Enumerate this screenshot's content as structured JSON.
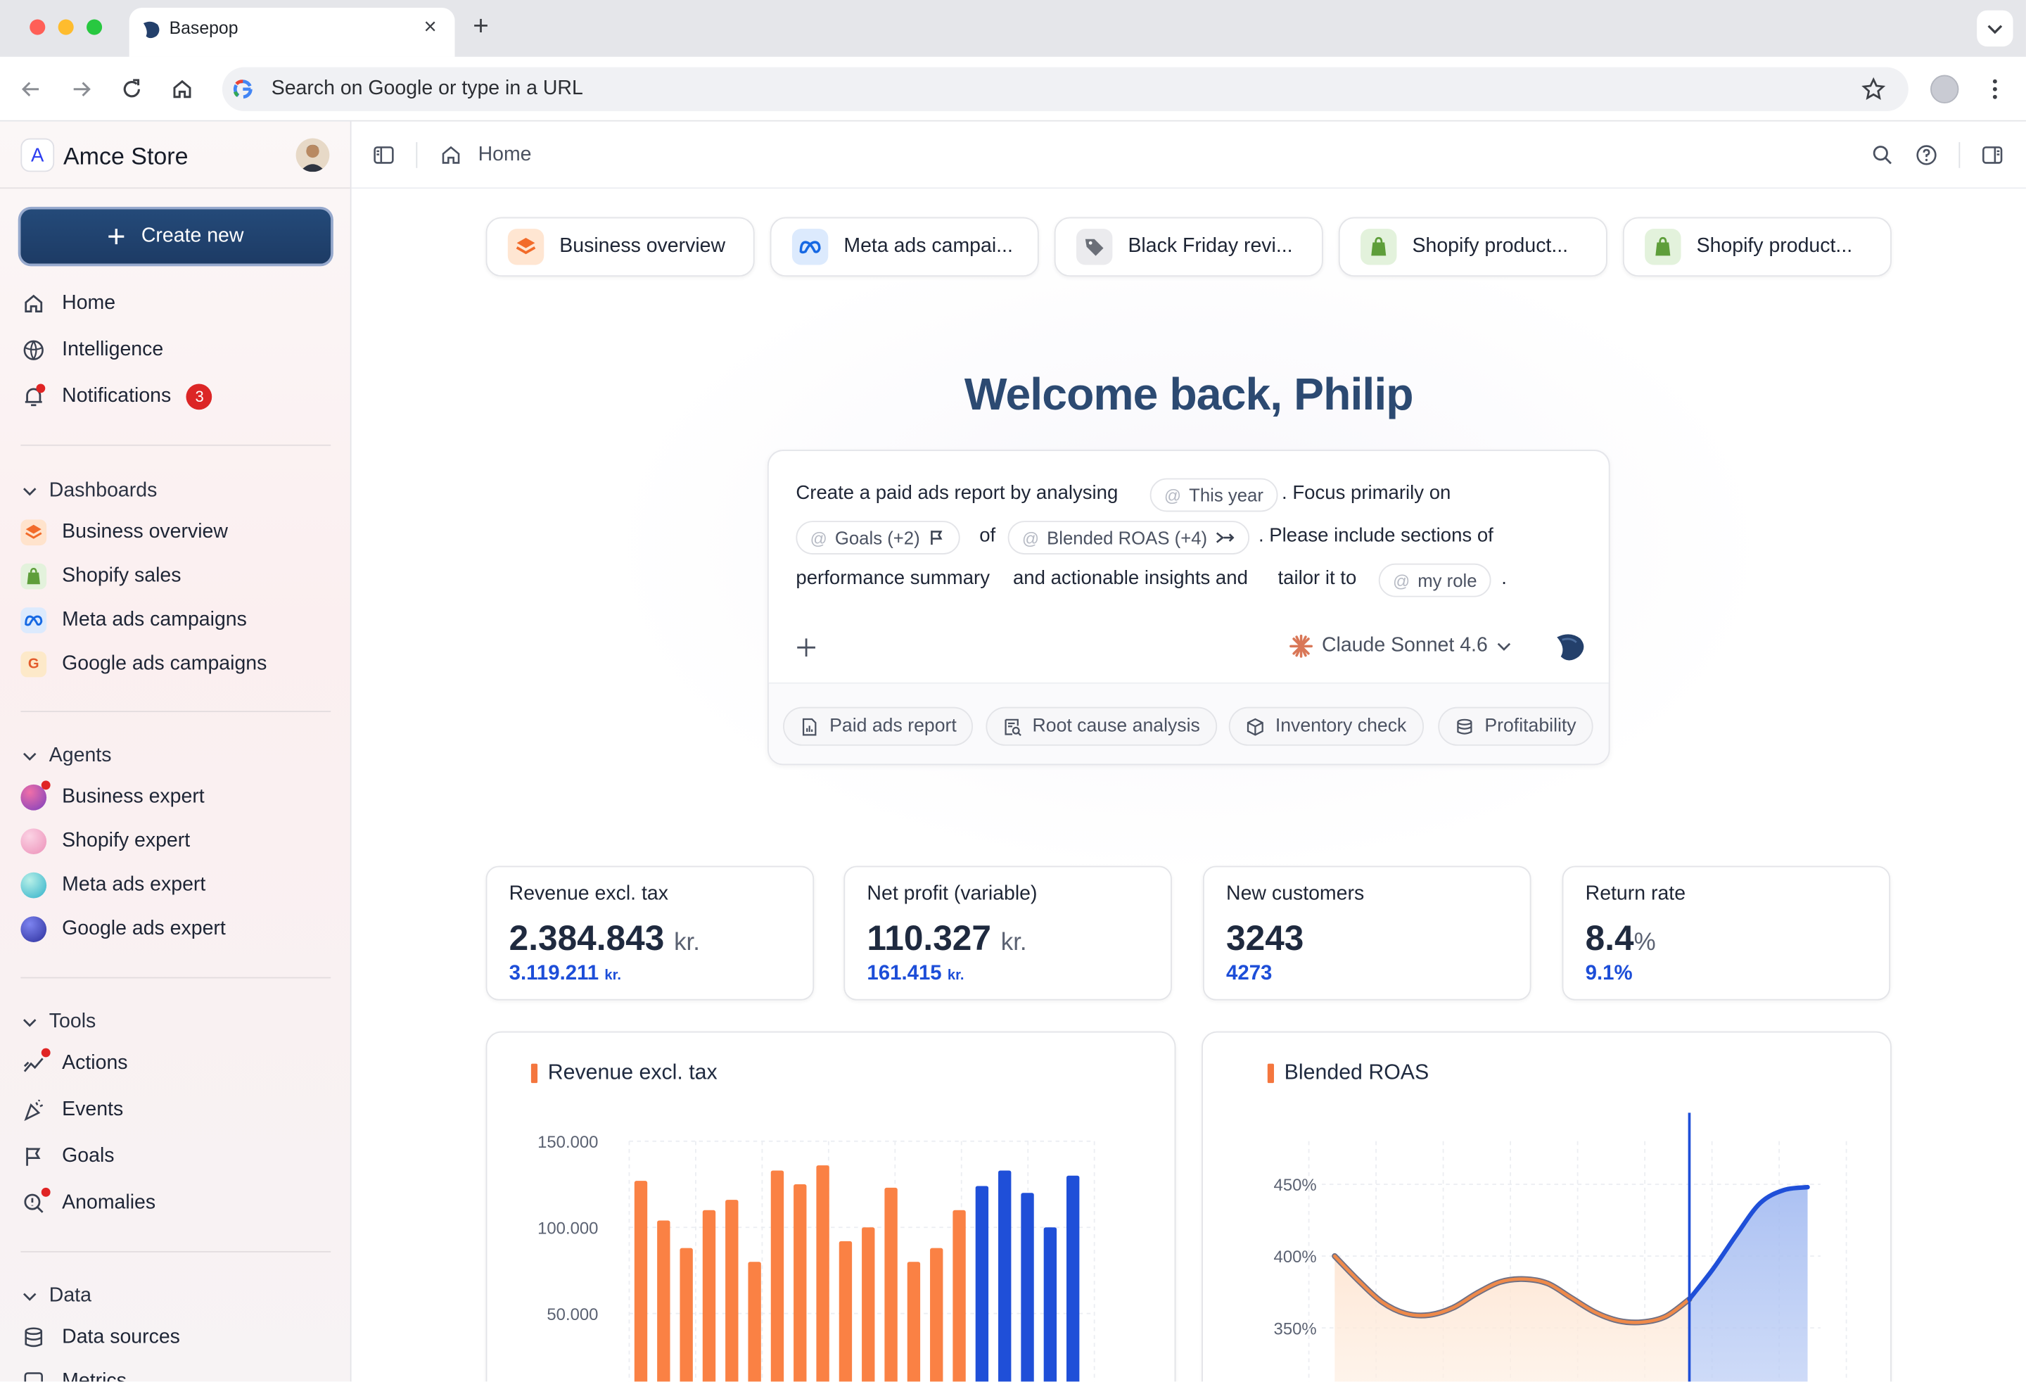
{
  "browser": {
    "tab_title": "Basepop",
    "tab_close": "×",
    "new_tab": "+",
    "omnibox_placeholder": "Search on Google or type in a URL"
  },
  "sidebar": {
    "store_initial": "A",
    "store_name": "Amce Store",
    "create_label": "Create new",
    "nav": [
      {
        "label": "Home",
        "icon": "home-icon"
      },
      {
        "label": "Intelligence",
        "icon": "intelligence-icon"
      },
      {
        "label": "Notifications",
        "icon": "bell-icon",
        "badge": "3"
      }
    ],
    "dashboards_title": "Dashboards",
    "dashboards": [
      {
        "label": "Business overview",
        "icon": "business-overview-icon"
      },
      {
        "label": "Shopify sales",
        "icon": "shopify-icon"
      },
      {
        "label": "Meta ads campaigns",
        "icon": "meta-icon"
      },
      {
        "label": "Google ads campaigns",
        "icon": "google-icon"
      }
    ],
    "agents_title": "Agents",
    "agents": [
      {
        "label": "Business expert",
        "color": "#7b3fbe"
      },
      {
        "label": "Shopify expert",
        "color": "#f3a6c8"
      },
      {
        "label": "Meta ads expert",
        "color": "#46c6c9"
      },
      {
        "label": "Google ads expert",
        "color": "#3d3fb3"
      }
    ],
    "tools_title": "Tools",
    "tools": [
      {
        "label": "Actions",
        "icon": "actions-icon"
      },
      {
        "label": "Events",
        "icon": "events-icon"
      },
      {
        "label": "Goals",
        "icon": "flag-icon"
      },
      {
        "label": "Anomalies",
        "icon": "anomalies-icon"
      }
    ],
    "data_title": "Data",
    "data_items": [
      {
        "label": "Data sources",
        "icon": "database-icon"
      },
      {
        "label": "Metrics",
        "icon": "metrics-icon"
      }
    ]
  },
  "header": {
    "breadcrumb": "Home"
  },
  "chips": [
    {
      "label": "Business overview"
    },
    {
      "label": "Meta ads campai..."
    },
    {
      "label": "Black Friday revi..."
    },
    {
      "label": "Shopify product..."
    },
    {
      "label": "Shopify product..."
    }
  ],
  "welcome": "Welcome back, Philip",
  "prompt": {
    "t1": "Create a paid ads report by analysing",
    "p_year": "This year",
    "t2": ". Focus primarily on",
    "p_goals": "Goals (+2)",
    "t3": "of",
    "p_roas": "Blended ROAS (+4)",
    "t4": ". Please include sections of",
    "t5": "performance summary",
    "t6": "and actionable insights and",
    "t7": "tailor it to",
    "p_role": "my role",
    "t8": ".",
    "at": "@",
    "model": "Claude Sonnet 4.6"
  },
  "suggestions": [
    {
      "label": "Paid ads report"
    },
    {
      "label": "Root cause analysis"
    },
    {
      "label": "Inventory check"
    },
    {
      "label": "Profitability"
    }
  ],
  "kpis": [
    {
      "label": "Revenue excl. tax",
      "value": "2.384.843",
      "unit": "kr.",
      "compare": "3.119.211",
      "compare_unit": "kr."
    },
    {
      "label": "Net profit (variable)",
      "value": "110.327",
      "unit": "kr.",
      "compare": "161.415",
      "compare_unit": "kr."
    },
    {
      "label": "New customers",
      "value": "3243",
      "unit": "",
      "compare": "4273",
      "compare_unit": ""
    },
    {
      "label": "Return rate",
      "value": "8.4",
      "unit": "%",
      "compare": "9.1%",
      "compare_unit": ""
    }
  ],
  "chart_data": [
    {
      "type": "bar",
      "title": "Revenue excl. tax",
      "yticks": [
        "150.000",
        "100.000",
        "50.000"
      ],
      "ylim": [
        0,
        150000
      ],
      "grid": true,
      "colors": {
        "past": "#fa8144",
        "current": "#1f4fd8"
      },
      "values": [
        127000,
        104000,
        88000,
        110000,
        116000,
        80000,
        133000,
        125000,
        136000,
        92000,
        100000,
        123000,
        80000,
        88000,
        110000,
        124000,
        133000,
        120000,
        100000,
        130000
      ],
      "highlight_from_index": 15
    },
    {
      "type": "area",
      "title": "Blended ROAS",
      "yticks": [
        "450%",
        "400%",
        "350%"
      ],
      "ylim": [
        300,
        480
      ],
      "grid": true,
      "colors": {
        "past": "#ef8a4a",
        "current": "#1f4fd8"
      },
      "x": [
        0,
        5,
        10,
        15,
        20,
        25,
        30,
        35,
        40,
        45,
        50,
        55,
        60,
        65,
        70,
        75,
        80,
        85,
        90,
        95,
        100
      ],
      "y": [
        400,
        383,
        368,
        360,
        359,
        364,
        374,
        382,
        384,
        381,
        371,
        361,
        355,
        354,
        358,
        370,
        391,
        415,
        437,
        446,
        448
      ],
      "marker_x": 75
    }
  ]
}
